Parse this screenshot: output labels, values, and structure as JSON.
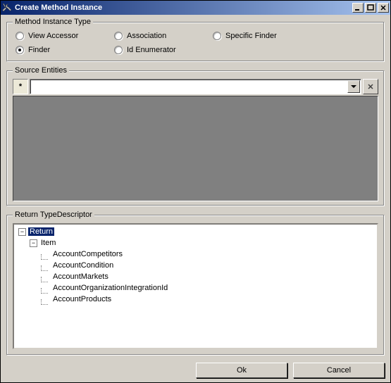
{
  "window": {
    "title": "Create Method Instance"
  },
  "groups": {
    "method_instance_type": "Method Instance Type",
    "source_entities": "Source Entities",
    "return_type_descriptor": "Return TypeDescriptor"
  },
  "radios": {
    "view_accessor": {
      "label": "View Accessor",
      "checked": false
    },
    "association": {
      "label": "Association",
      "checked": false
    },
    "specific_finder": {
      "label": "Specific Finder",
      "checked": false
    },
    "finder": {
      "label": "Finder",
      "checked": true
    },
    "id_enumerator": {
      "label": "Id Enumerator",
      "checked": false
    }
  },
  "source_entities": {
    "new_row_marker": "*",
    "combo_value": "",
    "delete_glyph": "✕"
  },
  "tree": {
    "root": {
      "label": "Return",
      "expanded": true,
      "children": [
        {
          "label": "Item",
          "expanded": true,
          "children": [
            {
              "label": "AccountCompetitors"
            },
            {
              "label": "AccountCondition"
            },
            {
              "label": "AccountMarkets"
            },
            {
              "label": "AccountOrganizationIntegrationId"
            },
            {
              "label": "AccountProducts"
            }
          ]
        }
      ]
    }
  },
  "buttons": {
    "ok": "Ok",
    "cancel": "Cancel"
  }
}
